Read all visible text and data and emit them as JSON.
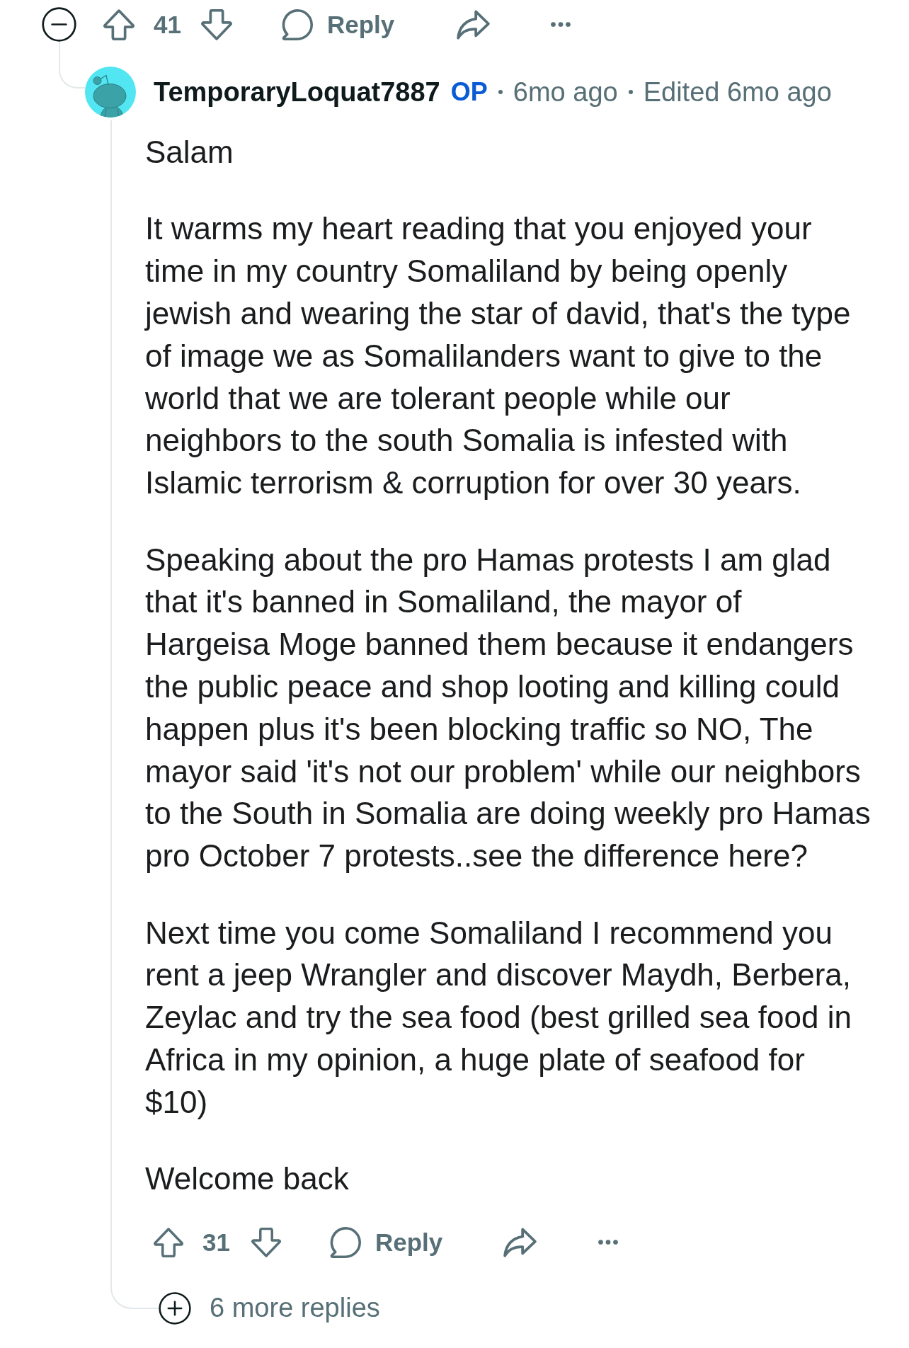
{
  "parent_actions": {
    "score": "41",
    "reply": "Reply"
  },
  "comment": {
    "author": "TemporaryLoquat7887",
    "badge": "OP",
    "meta": [
      "6mo ago",
      "Edited 6mo ago"
    ],
    "paragraphs": [
      [
        "Salam"
      ],
      [
        "It warms my heart reading that you enjoyed your",
        "time in my country Somaliland by being openly",
        "jewish and wearing the star of david, that's the type",
        "of image we as Somalilanders want to give to the",
        "world that we are tolerant people while our",
        "neighbors to the south Somalia is infested with",
        "Islamic terrorism & corruption for over 30 years."
      ],
      [
        "Speaking about the pro Hamas protests I am glad",
        "that it's banned in Somaliland, the mayor of",
        "Hargeisa Moge banned them because it endangers",
        "the public peace and shop looting and killing could",
        "happen plus it's been blocking traffic so NO, The",
        "mayor said 'it's not our problem' while our neighbors",
        "to the South in Somalia are doing weekly pro Hamas",
        "pro October 7 protests..see the difference here?"
      ],
      [
        "Next time you come Somaliland I recommend you",
        "rent a jeep Wrangler and discover Maydh, Berbera,",
        "Zeylac and try the sea food (best grilled sea food in",
        "Africa in my opinion, a huge plate of seafood for",
        "$10)"
      ],
      [
        "Welcome back"
      ]
    ],
    "actions": {
      "score": "31",
      "reply": "Reply"
    }
  },
  "more_replies": {
    "label": "6 more replies"
  }
}
